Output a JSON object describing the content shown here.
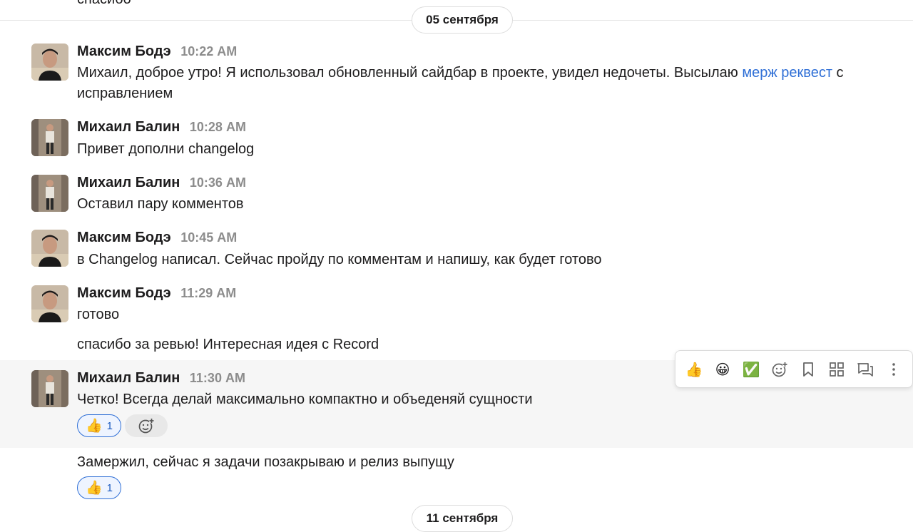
{
  "top_cut_text": "спасибо",
  "dates": {
    "first": "05 сентября",
    "second": "11 сентября"
  },
  "messages": [
    {
      "author": "Максим Бодэ",
      "time": "10:22 AM",
      "text_pre": "Михаил, доброе утро! Я использовал обновленный сайдбар в проекте, увидел недочеты. Высылаю ",
      "link": "мерж реквест",
      "text_post": " с исправлением"
    },
    {
      "author": "Михаил Балин",
      "time": "10:28 AM",
      "text": "Привет дополни changelog"
    },
    {
      "author": "Михаил Балин",
      "time": "10:36 AM",
      "text": "Оставил пару комментов"
    },
    {
      "author": "Максим Бодэ",
      "time": "10:45 AM",
      "text": "в Changelog написал. Сейчас пройду по комментам и напишу, как будет готово"
    },
    {
      "author": "Максим Бодэ",
      "time": "11:29 AM",
      "text": "готово",
      "followup": "спасибо за ревью! Интересная идея с Record"
    },
    {
      "author": "Михаил Балин",
      "time": "11:30 AM",
      "text": "Четко! Всегда делай максимально компактно и объеденяй сущности",
      "reaction_count": "1",
      "followup": "Замержил, сейчас я задачи позакрываю и релиз выпущу",
      "followup_reaction_count": "1"
    }
  ],
  "icons": {
    "thumbs_up": "👍",
    "grin": "😀",
    "check": "✅"
  },
  "colors": {
    "link": "#2f6fd6",
    "hover_row": "#f6f6f6",
    "reaction_border": "#2f6fd6"
  }
}
